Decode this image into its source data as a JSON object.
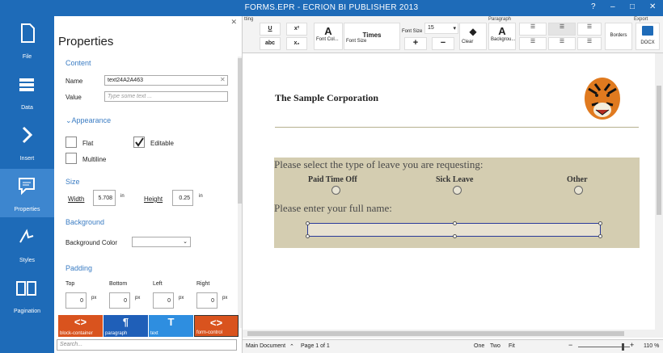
{
  "window": {
    "title": "FORMS.EPR - ECRION BI PUBLISHER 2013",
    "help": "?",
    "minimize": "–",
    "maximize": "□",
    "close": "✕"
  },
  "nav": [
    {
      "label": "File",
      "icon": "file-icon"
    },
    {
      "label": "Data",
      "icon": "data-icon"
    },
    {
      "label": "Insert",
      "icon": "insert-icon"
    },
    {
      "label": "Properties",
      "icon": "properties-icon"
    },
    {
      "label": "Styles",
      "icon": "styles-icon"
    },
    {
      "label": "Pagination",
      "icon": "pagination-icon"
    }
  ],
  "properties": {
    "title": "Properties",
    "content_section": "Content",
    "name_label": "Name",
    "name_value": "text24A2A463",
    "value_label": "Value",
    "value_placeholder": "Type some text ...",
    "appearance_section": "Appearance",
    "flat_label": "Flat",
    "editable_label": "Editable",
    "multiline_label": "Multiline",
    "size_section": "Size",
    "width_label": "Width",
    "width_value": "5.708",
    "width_unit": "in",
    "height_label": "Height",
    "height_value": "0.25",
    "height_unit": "in",
    "background_section": "Background",
    "bgcolor_label": "Background Color",
    "padding_section": "Padding",
    "top_label": "Top",
    "bottom_label": "Bottom",
    "left_label": "Left",
    "right_label": "Right",
    "pad_top": "0",
    "pad_bottom": "0",
    "pad_left": "0",
    "pad_right": "0",
    "pad_unit": "px",
    "breadcrumbs": [
      {
        "label": "block-container",
        "icon": "<>",
        "color": "#d9531e"
      },
      {
        "label": "paragraph",
        "icon": "¶",
        "color": "#1f5fb8"
      },
      {
        "label": "text",
        "icon": "T",
        "color": "#2e8ee0"
      },
      {
        "label": "form-control",
        "icon": "<>",
        "color": "#d9531e"
      }
    ],
    "search_placeholder": "Search..."
  },
  "ribbon": {
    "group_formatting": "tting",
    "group_paragraph": "Paragraph",
    "group_export": "Export",
    "underline": "U",
    "superscript": "x²",
    "strike": "abc",
    "subscript": "x₂",
    "font_color_icon": "A",
    "font_color_label": "Font Col...",
    "font_name": "Times",
    "font_size_group": "Font Size",
    "font_size_label": "Font Size",
    "font_size_value": "15",
    "plus": "+",
    "minus": "−",
    "clear_label": "Clear",
    "bg_icon": "A",
    "bg_label": "Backgrou...",
    "borders_label": "Borders",
    "docx_label": "DOCX"
  },
  "document": {
    "company": "The Sample Corporation",
    "question1": "Please select the type of leave you are requesting:",
    "options": [
      "Paid Time Off",
      "Sick Leave",
      "Other"
    ],
    "question2": "Please enter your full name:"
  },
  "status": {
    "view": "Main Document",
    "page": "Page 1 of 1",
    "one": "One",
    "two": "Two",
    "fit": "Fit",
    "zoom": "110 %"
  },
  "colors": {
    "accent": "#1e6bb8",
    "form_bg": "#d4cdb1",
    "rule": "#b5b08f"
  }
}
